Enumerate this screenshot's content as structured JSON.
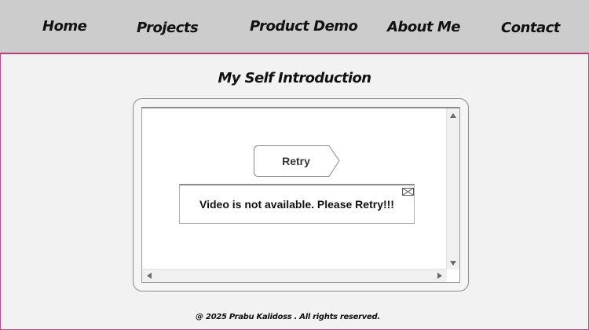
{
  "nav": {
    "items": [
      {
        "label": "Home"
      },
      {
        "label": "Projects"
      },
      {
        "label": "Product Demo"
      },
      {
        "label": "About Me"
      },
      {
        "label": "Contact"
      }
    ]
  },
  "main": {
    "heading": "My Self Introduction",
    "player": {
      "retry_label": "Retry",
      "error_message": "Video is not available. Please Retry!!!"
    }
  },
  "footer": {
    "text": "@ 2025 Prabu Kalidoss . All rights reserved."
  },
  "colors": {
    "nav_background": "#cccccc",
    "page_background": "#f2f2f2",
    "accent_border": "#b8407f"
  }
}
